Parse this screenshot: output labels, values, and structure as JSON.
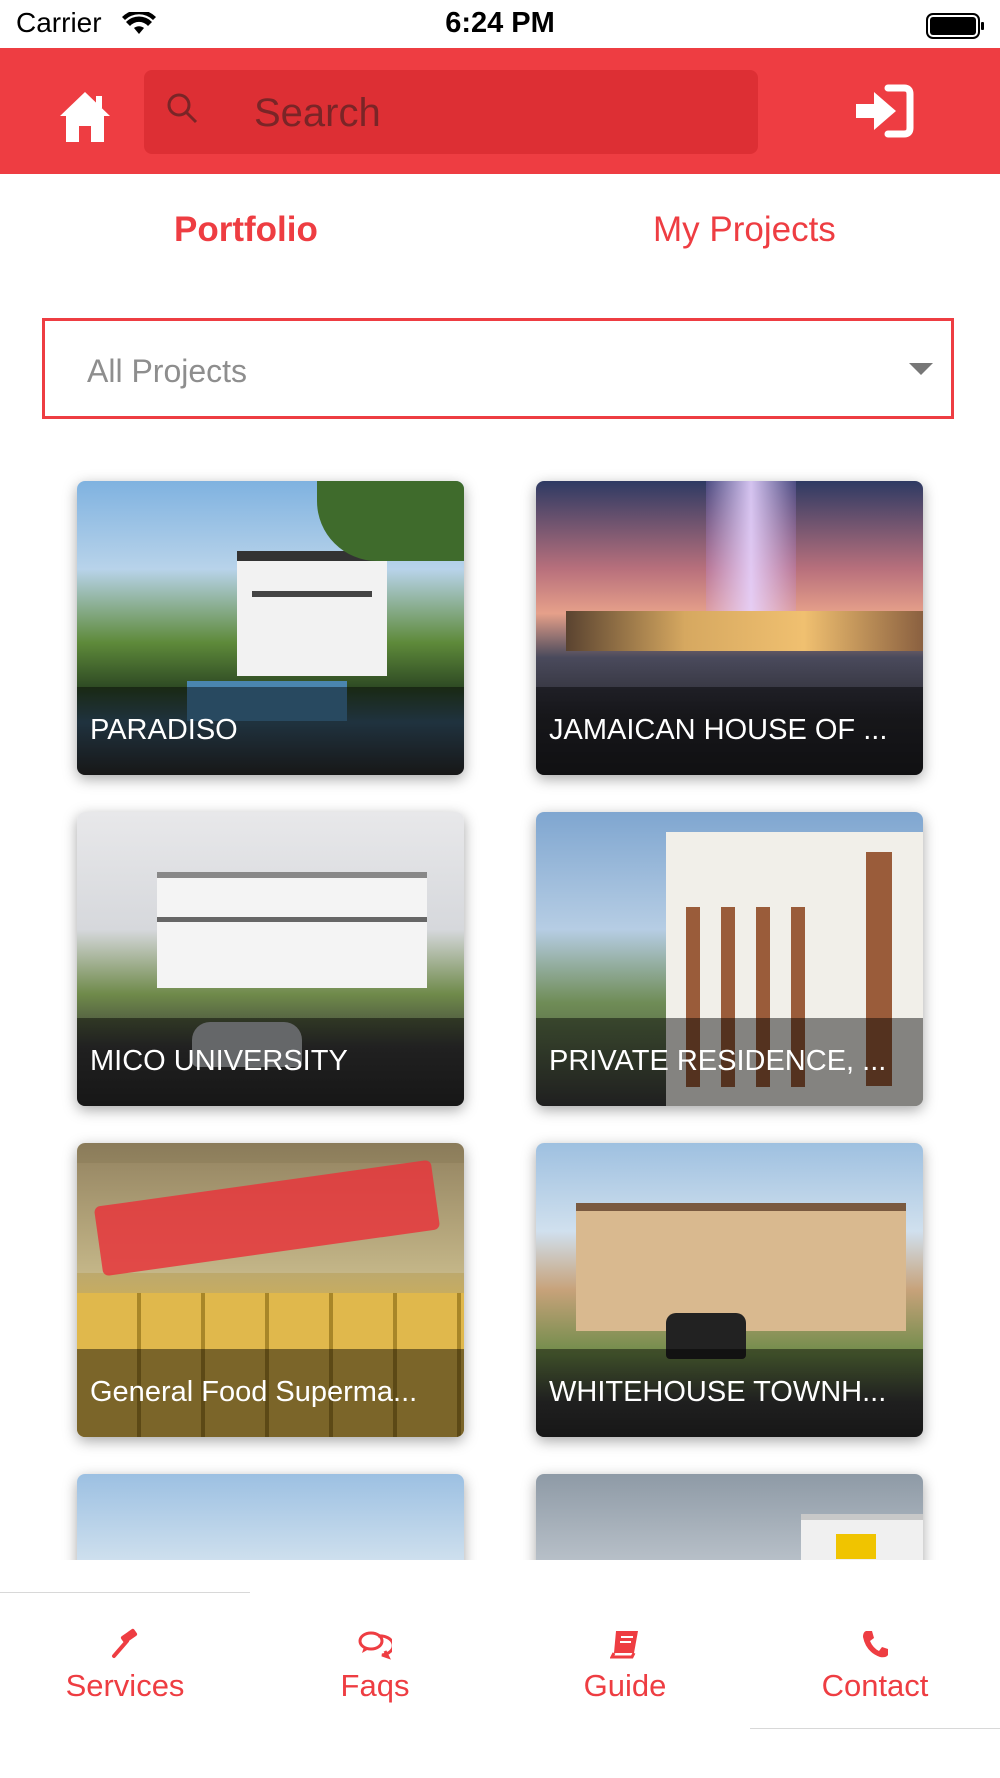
{
  "status_bar": {
    "carrier": "Carrier",
    "time": "6:24 PM"
  },
  "header": {
    "search_placeholder": "Search"
  },
  "tabs": [
    {
      "label": "Portfolio",
      "active": true
    },
    {
      "label": "My Projects",
      "active": false
    }
  ],
  "filter": {
    "selected": "All Projects"
  },
  "projects": [
    {
      "title": "PARADISO"
    },
    {
      "title": "JAMAICAN HOUSE OF ..."
    },
    {
      "title": "MICO UNIVERSITY"
    },
    {
      "title": "PRIVATE RESIDENCE, ..."
    },
    {
      "title": "General Food Superma..."
    },
    {
      "title": "WHITEHOUSE TOWNH..."
    }
  ],
  "bottom_nav": [
    {
      "label": "Services",
      "icon": "hammer-icon"
    },
    {
      "label": "Faqs",
      "icon": "chat-bubbles-icon"
    },
    {
      "label": "Guide",
      "icon": "book-icon"
    },
    {
      "label": "Contact",
      "icon": "phone-icon"
    }
  ],
  "colors": {
    "brand": "#ee3d42",
    "brand_dark": "#dd2f34"
  }
}
